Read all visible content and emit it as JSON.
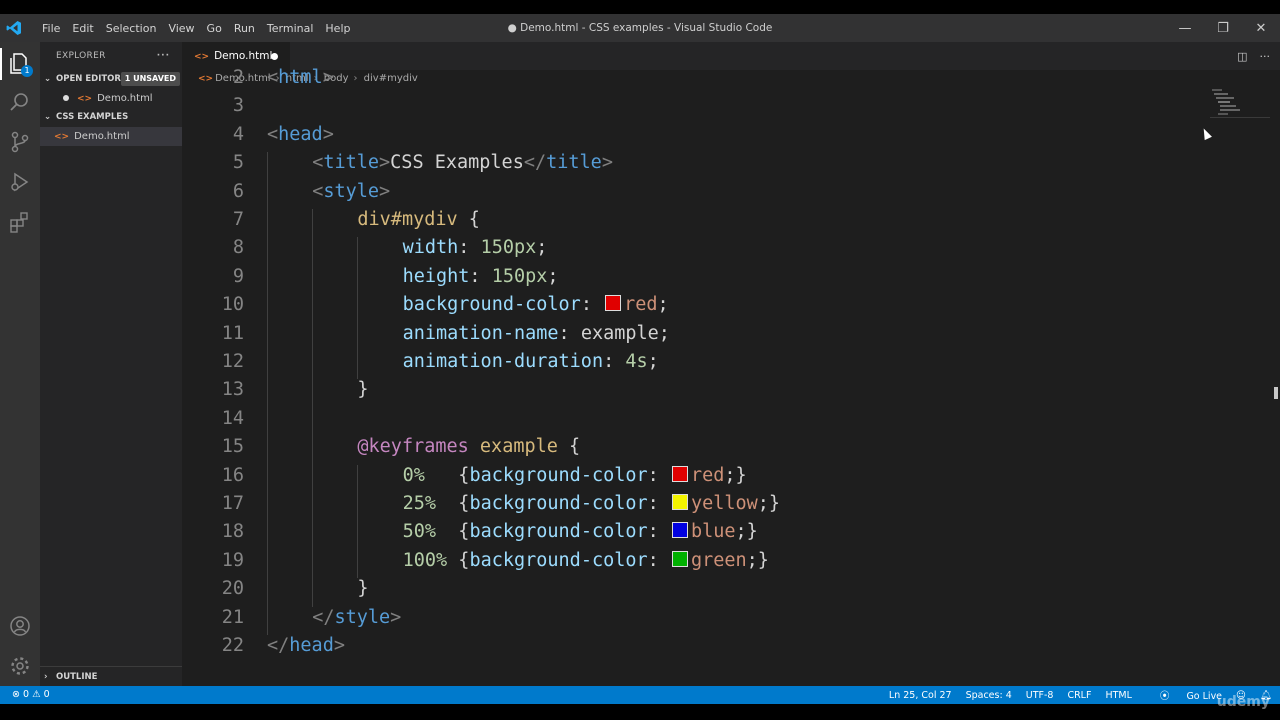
{
  "app": {
    "window_title": "● Demo.html - CSS examples - Visual Studio Code",
    "menu": [
      "File",
      "Edit",
      "Selection",
      "View",
      "Go",
      "Run",
      "Terminal",
      "Help"
    ],
    "window_controls": {
      "minimize": "—",
      "restore": "❐",
      "close": "✕"
    }
  },
  "activity_bar": {
    "items": [
      "explorer-icon",
      "search-icon",
      "source-control-icon",
      "run-debug-icon",
      "extensions-icon"
    ],
    "bottom": [
      "account-icon",
      "gear-icon"
    ],
    "explorer_badge": "1"
  },
  "sidebar": {
    "title": "EXPLORER",
    "more": "···",
    "open_editors": {
      "label": "OPEN EDITORS",
      "badge": "1 UNSAVED",
      "files": [
        "Demo.html"
      ]
    },
    "folder": {
      "label": "CSS EXAMPLES",
      "files": [
        "Demo.html"
      ]
    },
    "outline": "OUTLINE",
    "file_icon": "<>"
  },
  "editor": {
    "tab": {
      "label": "Demo.html"
    },
    "breadcrumb": [
      "Demo.html",
      "html",
      "body",
      "div#mydiv"
    ],
    "code_lines": [
      {
        "n": "2",
        "text": "<html>"
      },
      {
        "n": "3",
        "text": ""
      },
      {
        "n": "4",
        "text": "<head>"
      },
      {
        "n": "5",
        "text": "<title>CSS Examples</title>"
      },
      {
        "n": "6",
        "text": "<style>"
      },
      {
        "n": "7",
        "text": "div#mydiv {"
      },
      {
        "n": "8",
        "text": "width: 150px;"
      },
      {
        "n": "9",
        "text": "height: 150px;"
      },
      {
        "n": "10",
        "text": "background-color: red;"
      },
      {
        "n": "11",
        "text": "animation-name: example;"
      },
      {
        "n": "12",
        "text": "animation-duration: 4s;"
      },
      {
        "n": "13",
        "text": "}"
      },
      {
        "n": "14",
        "text": ""
      },
      {
        "n": "15",
        "text": "@keyframes example {"
      },
      {
        "n": "16",
        "text": "0%   {background-color: red;}"
      },
      {
        "n": "17",
        "text": "25%  {background-color: yellow;}"
      },
      {
        "n": "18",
        "text": "50%  {background-color: blue;}"
      },
      {
        "n": "19",
        "text": "100% {background-color: green;}"
      },
      {
        "n": "20",
        "text": "}"
      },
      {
        "n": "21",
        "text": "</style>"
      },
      {
        "n": "22",
        "text": "</head>"
      }
    ],
    "swatch_colors": {
      "red": "#e00000",
      "yellow": "#f5f500",
      "blue": "#0000e0",
      "green": "#00b000"
    }
  },
  "status_bar": {
    "errors": "0",
    "warnings": "0",
    "position": "Ln 25, Col 27",
    "spaces": "Spaces: 4",
    "encoding": "UTF-8",
    "eol": "CRLF",
    "language": "HTML",
    "go_live": "Go Live"
  },
  "watermark": "udemy",
  "colors": {
    "accent": "#007acc",
    "editor_bg": "#1e1e1e",
    "sidebar_bg": "#252526"
  }
}
